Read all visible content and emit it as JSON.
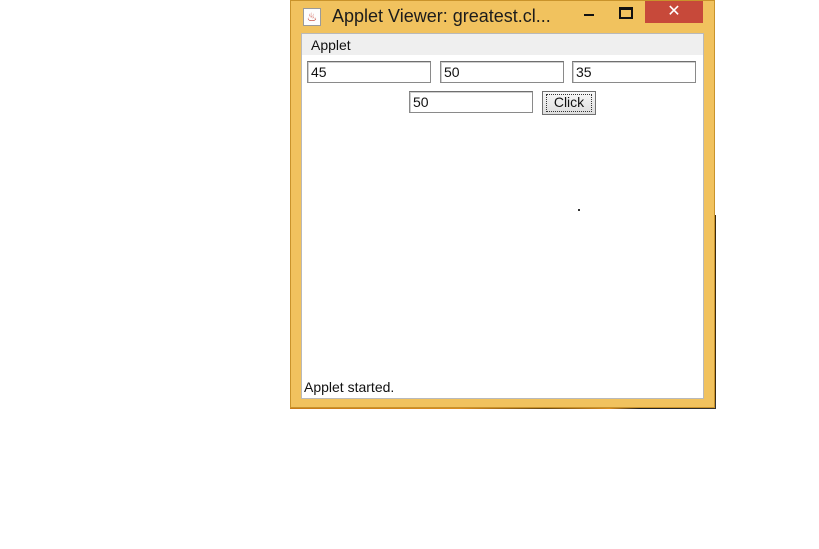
{
  "window": {
    "title": "Applet Viewer: greatest.cl...",
    "close_symbol": "✕"
  },
  "menu": {
    "items": [
      "Applet"
    ]
  },
  "fields": {
    "first": "45",
    "second": "50",
    "third": "35",
    "result": "50"
  },
  "button": {
    "label": "Click"
  },
  "status": {
    "text": "Applet started."
  },
  "icons": {
    "app": "java-cup-icon",
    "minimize": "minimize-icon",
    "maximize": "maximize-icon",
    "close": "close-icon"
  },
  "colors": {
    "window_frame": "#f1c25e",
    "close_button": "#c7493a"
  }
}
